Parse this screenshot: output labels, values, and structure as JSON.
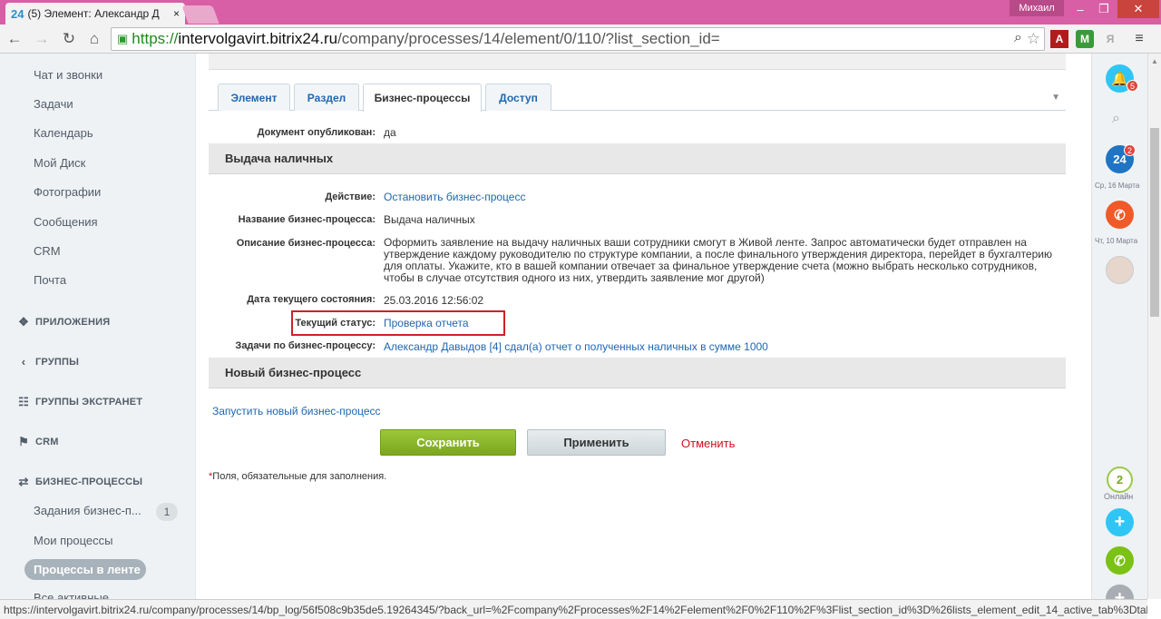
{
  "browser": {
    "tab_favicon": "24",
    "tab_title": "(5) Элемент: Александр Д",
    "tab_close": "×",
    "user_name": "Михаил",
    "url_scheme": "https://",
    "url_host": "intervolgavirt.bitrix24.ru",
    "url_path": "/company/processes/14/element/0/110/?list_section_id=",
    "status_url": "https://intervolgavirt.bitrix24.ru/company/processes/14/bp_log/56f508c9b35de5.19264345/?back_url=%2Fcompany%2Fprocesses%2F14%2Felement%2F0%2F110%2F%3Flist_section_id%3D%26lists_element_edit_14_active_tab%3Dtab_bp"
  },
  "sidebar": {
    "items": [
      {
        "label": "Чат и звонки"
      },
      {
        "label": "Задачи"
      },
      {
        "label": "Календарь"
      },
      {
        "label": "Мой Диск"
      },
      {
        "label": "Фотографии"
      },
      {
        "label": "Сообщения"
      },
      {
        "label": "CRM"
      },
      {
        "label": "Почта"
      }
    ],
    "sections": [
      {
        "label": "ПРИЛОЖЕНИЯ",
        "icon": "apps-icon"
      },
      {
        "label": "ГРУППЫ",
        "icon": "share-icon"
      },
      {
        "label": "ГРУППЫ ЭКСТРАНЕТ",
        "icon": "extranet-icon"
      },
      {
        "label": "CRM",
        "icon": "flag-icon"
      },
      {
        "label": "БИЗНЕС-ПРОЦЕССЫ",
        "icon": "processes-icon"
      }
    ],
    "bp_items": [
      {
        "label": "Задания бизнес-п...",
        "count": "1"
      },
      {
        "label": "Мои процессы"
      },
      {
        "label": "Процессы в ленте"
      },
      {
        "label": "Все активные"
      }
    ]
  },
  "form": {
    "tabs": [
      {
        "label": "Элемент"
      },
      {
        "label": "Раздел"
      },
      {
        "label": "Бизнес-процессы"
      },
      {
        "label": "Доступ"
      }
    ],
    "published_label": "Документ опубликован:",
    "published_value": "да",
    "section1_title": "Выдача наличных",
    "fields": {
      "action_label": "Действие:",
      "action_value": "Остановить бизнес-процесс",
      "name_label": "Название бизнес-процесса:",
      "name_value": "Выдача наличных",
      "desc_label": "Описание бизнес-процесса:",
      "desc_value": "Оформить заявление на выдачу наличных ваши сотрудники смогут в Живой ленте. Запрос автоматически будет отправлен на утверждение каждому руководителю по структуре компании, а после финального утверждения директора, перейдет в бухгалтерию для оплаты. Укажите, кто в вашей компании отвечает за финальное утверждение счета (можно выбрать несколько сотрудников, чтобы в случае отсутствия одного из них, утвердить заявление мог другой)",
      "date_label": "Дата текущего состояния:",
      "date_value": "25.03.2016 12:56:02",
      "status_label": "Текущий статус:",
      "status_value": "Проверка отчета",
      "tasks_label": "Задачи по бизнес-процессу:",
      "tasks_value": "Александр Давыдов [4] сдал(а) отчет о полученных наличных в сумме 1000"
    },
    "section2_title": "Новый бизнес-процесс",
    "start_new_link": "Запустить новый бизнес-процесс",
    "save_label": "Сохранить",
    "apply_label": "Применить",
    "cancel_label": "Отменить",
    "required_star": "*",
    "required_note": "Поля, обязательные для заполнения."
  },
  "right_panel": {
    "notif_badge": "5",
    "b24_label": "24",
    "b24_badge": "2",
    "date1": "Ср, 16 Марта",
    "date2": "Чт, 10 Марта",
    "online_count": "2",
    "online_label": "Онлайн"
  },
  "colors": {
    "title_bar": "#d85ea5",
    "sidebar_bg": "#eef2f4",
    "link": "#2067b0",
    "save_button": "#8bb82c",
    "cancel": "#d0101c",
    "highlight": "#d21e2b"
  }
}
